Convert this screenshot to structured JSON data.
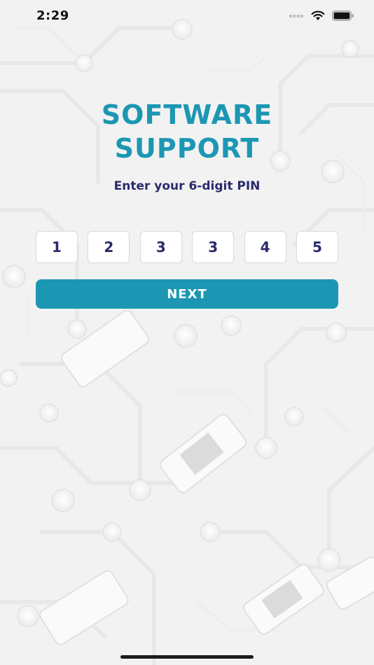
{
  "status_bar": {
    "time": "2:29"
  },
  "app": {
    "title_line1": "SOFTWARE",
    "title_line2": "SUPPORT",
    "subtitle": "Enter your 6-digit PIN"
  },
  "pin": {
    "digits": [
      "1",
      "2",
      "3",
      "3",
      "4",
      "5"
    ]
  },
  "actions": {
    "next_label": "NEXT"
  },
  "colors": {
    "accent": "#1c97b3",
    "text_dark": "#2a2a6c",
    "background": "#eeeeee"
  }
}
